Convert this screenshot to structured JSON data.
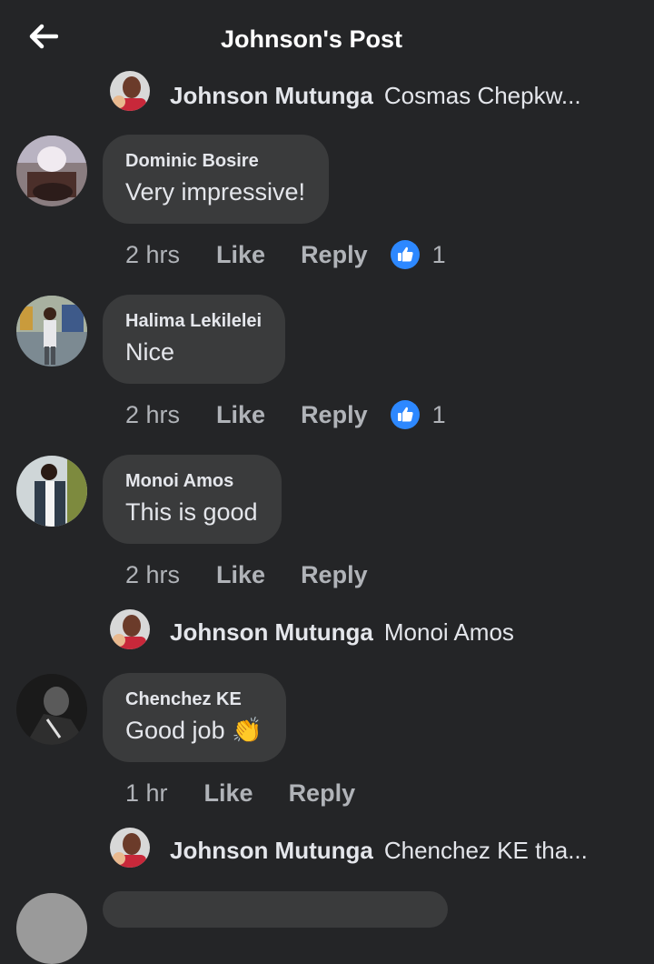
{
  "header": {
    "title": "Johnson's Post",
    "back_icon": "arrow-left-icon"
  },
  "replies": [
    {
      "author": "Johnson Mutunga",
      "snippet": "Cosmas Chepkw..."
    },
    {
      "author": "Johnson Mutunga",
      "snippet": "Monoi Amos"
    },
    {
      "author": "Johnson Mutunga",
      "snippet": "Chenchez KE tha..."
    }
  ],
  "comments": [
    {
      "name": "Dominic Bosire",
      "text": "Very impressive!",
      "time": "2 hrs",
      "like": "Like",
      "reply": "Reply",
      "likes": "1"
    },
    {
      "name": "Halima Lekilelei",
      "text": "Nice",
      "time": "2 hrs",
      "like": "Like",
      "reply": "Reply",
      "likes": "1"
    },
    {
      "name": "Monoi Amos",
      "text": "This is good",
      "time": "2 hrs",
      "like": "Like",
      "reply": "Reply"
    },
    {
      "name": "Chenchez KE",
      "text": "Good job",
      "emoji": "👏",
      "time": "1 hr",
      "like": "Like",
      "reply": "Reply"
    }
  ],
  "colors": {
    "background": "#242527",
    "bubble": "#3a3b3c",
    "like_badge": "#2d88ff",
    "secondary_text": "#b0b3b8"
  }
}
